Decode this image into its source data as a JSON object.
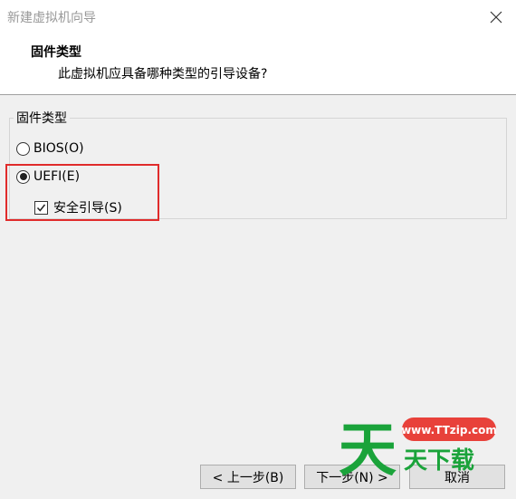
{
  "window": {
    "title": "新建虚拟机向导"
  },
  "header": {
    "title": "固件类型",
    "subtitle": "此虚拟机应具备哪种类型的引导设备?"
  },
  "firmware_group": {
    "label": "固件类型",
    "options": [
      {
        "label": "BIOS(O)",
        "selected": false
      },
      {
        "label": "UEFI(E)",
        "selected": true
      }
    ],
    "secure_boot": {
      "label": "安全引导(S)",
      "checked": true
    }
  },
  "buttons": {
    "back": "< 上一步(B)",
    "next": "下一步(N) >",
    "cancel": "取消"
  },
  "watermark": {
    "url": "www.TTzip.com",
    "text": "天下载"
  },
  "colors": {
    "highlight": "#e02b2b",
    "watermark_green": "#1aa33a",
    "watermark_red": "#e8413a"
  }
}
